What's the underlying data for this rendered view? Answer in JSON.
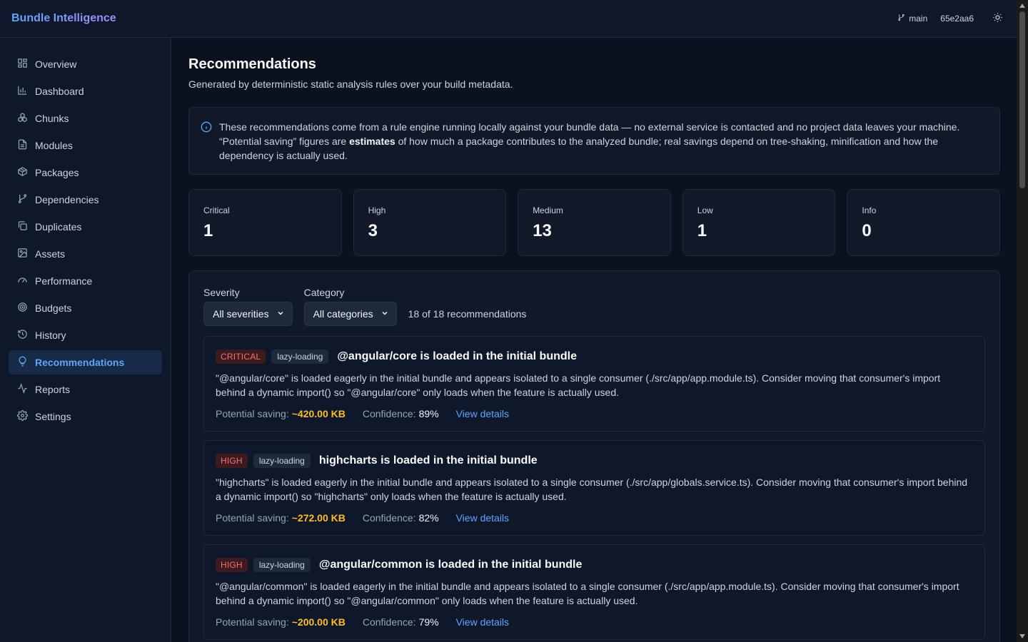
{
  "app": {
    "title": "Bundle Intelligence"
  },
  "topbar": {
    "branch": "main",
    "commit": "65e2aa6"
  },
  "sidebar": {
    "items": [
      {
        "label": "Overview",
        "icon": "overview-icon"
      },
      {
        "label": "Dashboard",
        "icon": "bar-chart-icon"
      },
      {
        "label": "Chunks",
        "icon": "chunks-icon"
      },
      {
        "label": "Modules",
        "icon": "file-icon"
      },
      {
        "label": "Packages",
        "icon": "package-icon"
      },
      {
        "label": "Dependencies",
        "icon": "branch-icon"
      },
      {
        "label": "Duplicates",
        "icon": "copy-icon"
      },
      {
        "label": "Assets",
        "icon": "image-icon"
      },
      {
        "label": "Performance",
        "icon": "gauge-icon"
      },
      {
        "label": "Budgets",
        "icon": "target-icon"
      },
      {
        "label": "History",
        "icon": "history-icon"
      },
      {
        "label": "Recommendations",
        "icon": "lightbulb-icon",
        "active": true
      },
      {
        "label": "Reports",
        "icon": "activity-icon"
      },
      {
        "label": "Settings",
        "icon": "gear-icon"
      }
    ]
  },
  "page": {
    "title": "Recommendations",
    "subtitle": "Generated by deterministic static analysis rules over your build metadata."
  },
  "info": {
    "before": "These recommendations come from a rule engine running locally against your bundle data — no external service is contacted and no project data leaves your machine. “Potential saving” figures are ",
    "bold": "estimates",
    "after": " of how much a package contributes to the analyzed bundle; real savings depend on tree-shaking, minification and how the dependency is actually used."
  },
  "stats": [
    {
      "label": "Critical",
      "value": "1"
    },
    {
      "label": "High",
      "value": "3"
    },
    {
      "label": "Medium",
      "value": "13"
    },
    {
      "label": "Low",
      "value": "1"
    },
    {
      "label": "Info",
      "value": "0"
    }
  ],
  "filters": {
    "severity_label": "Severity",
    "severity_value": "All severities",
    "category_label": "Category",
    "category_value": "All categories",
    "count": "18 of 18 recommendations"
  },
  "meta_labels": {
    "saving": "Potential saving:",
    "confidence": "Confidence:",
    "details": "View details"
  },
  "recommendations": [
    {
      "severity": "CRITICAL",
      "category": "lazy-loading",
      "title": "@angular/core is loaded in the initial bundle",
      "description": "\"@angular/core\" is loaded eagerly in the initial bundle and appears isolated to a single consumer (./src/app/app.module.ts). Consider moving that consumer's import behind a dynamic import() so \"@angular/core\" only loads when the feature is actually used.",
      "saving": "~420.00 KB",
      "confidence": "89%"
    },
    {
      "severity": "HIGH",
      "category": "lazy-loading",
      "title": "highcharts is loaded in the initial bundle",
      "description": "\"highcharts\" is loaded eagerly in the initial bundle and appears isolated to a single consumer (./src/app/globals.service.ts). Consider moving that consumer's import behind a dynamic import() so \"highcharts\" only loads when the feature is actually used.",
      "saving": "~272.00 KB",
      "confidence": "82%"
    },
    {
      "severity": "HIGH",
      "category": "lazy-loading",
      "title": "@angular/common is loaded in the initial bundle",
      "description": "\"@angular/common\" is loaded eagerly in the initial bundle and appears isolated to a single consumer (./src/app/app.module.ts). Consider moving that consumer's import behind a dynamic import() so \"@angular/common\" only loads when the feature is actually used.",
      "saving": "~200.00 KB",
      "confidence": "79%"
    }
  ]
}
